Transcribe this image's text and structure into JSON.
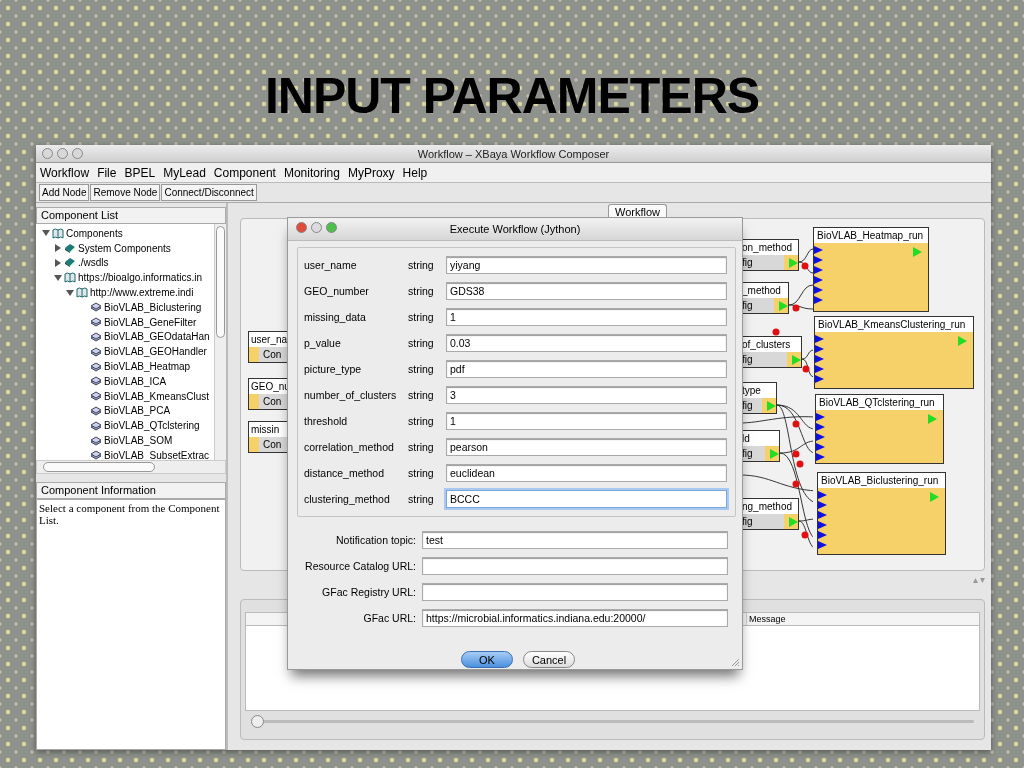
{
  "slide": {
    "title": "INPUT PARAMETERS"
  },
  "window": {
    "title": "Workflow – XBaya Workflow Composer"
  },
  "menu": [
    "Workflow",
    "File",
    "BPEL",
    "MyLead",
    "Component",
    "Monitoring",
    "MyProxy",
    "Help"
  ],
  "toolbar": [
    "Add Node",
    "Remove Node",
    "Connect/Disconnect"
  ],
  "component_list": {
    "title": "Component List",
    "tree": [
      {
        "label": "Components",
        "expanded": true,
        "children": [
          {
            "label": "System Components",
            "expanded": false
          },
          {
            "label": "./wsdls",
            "expanded": false
          },
          {
            "label": "https://bioalgo.informatics.in",
            "expanded": true,
            "children": [
              {
                "label": "http://www.extreme.indi",
                "expanded": true,
                "children": [
                  {
                    "label": "BioVLAB_Biclustering"
                  },
                  {
                    "label": "BioVLAB_GeneFilter"
                  },
                  {
                    "label": "BioVLAB_GEOdataHan"
                  },
                  {
                    "label": "BioVLAB_GEOHandler"
                  },
                  {
                    "label": "BioVLAB_Heatmap"
                  },
                  {
                    "label": "BioVLAB_ICA"
                  },
                  {
                    "label": "BioVLAB_KmeansClust"
                  },
                  {
                    "label": "BioVLAB_PCA"
                  },
                  {
                    "label": "BioVLAB_QTclstering"
                  },
                  {
                    "label": "BioVLAB_SOM"
                  },
                  {
                    "label": "BioVLAB_SubsetExtrac"
                  }
                ]
              }
            ]
          }
        ]
      }
    ]
  },
  "component_information": {
    "title": "Component Information",
    "text": "Select a component from the Component List."
  },
  "tabs": [
    {
      "label": "Workflow",
      "selected": true
    }
  ],
  "canvas": {
    "input_nodes": [
      {
        "name": "user_na",
        "button": "Con"
      },
      {
        "name": "GEO_nu",
        "button": "Con"
      },
      {
        "name": "missin",
        "button": "Con"
      },
      {
        "name": "on_method",
        "button": "fig"
      },
      {
        "name": "_method",
        "button": "fig"
      },
      {
        "name": "of_clusters",
        "button": "fig"
      },
      {
        "name": "type",
        "button": "fig"
      },
      {
        "name": "ld",
        "button": "fig"
      },
      {
        "name": "ng_method",
        "button": "fig"
      }
    ],
    "component_nodes": [
      {
        "name": "BioVLAB_Heatmap_run"
      },
      {
        "name": "BioVLAB_KmeansClustering_run"
      },
      {
        "name": "BioVLAB_QTclstering_run"
      },
      {
        "name": "BioVLAB_Biclustering_run"
      }
    ]
  },
  "message_table": {
    "columns": [
      "Message"
    ]
  },
  "dialog": {
    "title": "Execute Workflow (Jython)",
    "parameters": [
      {
        "name": "user_name",
        "type": "string",
        "value": "yiyang",
        "focused": false
      },
      {
        "name": "GEO_number",
        "type": "string",
        "value": "GDS38",
        "focused": false
      },
      {
        "name": "missing_data",
        "type": "string",
        "value": "1",
        "focused": false
      },
      {
        "name": "p_value",
        "type": "string",
        "value": "0.03",
        "focused": false
      },
      {
        "name": "picture_type",
        "type": "string",
        "value": "pdf",
        "focused": false
      },
      {
        "name": "number_of_clusters",
        "type": "string",
        "value": "3",
        "focused": false
      },
      {
        "name": "threshold",
        "type": "string",
        "value": "1",
        "focused": false
      },
      {
        "name": "correlation_method",
        "type": "string",
        "value": "pearson",
        "focused": false
      },
      {
        "name": "distance_method",
        "type": "string",
        "value": "euclidean",
        "focused": false
      },
      {
        "name": "clustering_method",
        "type": "string",
        "value": "BCCC",
        "focused": true
      }
    ],
    "settings": [
      {
        "label": "Notification topic:",
        "value": "test"
      },
      {
        "label": "Resource Catalog URL:"
      },
      {
        "label": "GFac Registry URL:"
      },
      {
        "label": "GFac URL:",
        "value": "https://microbial.informatics.indiana.edu:20000/"
      }
    ],
    "buttons": [
      {
        "label": "OK",
        "default": true
      },
      {
        "label": "Cancel",
        "default": false
      }
    ]
  }
}
